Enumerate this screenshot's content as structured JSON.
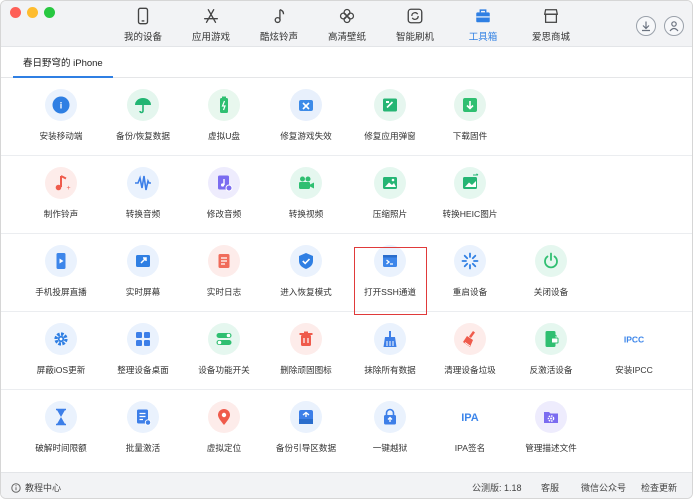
{
  "nav": [
    {
      "label": "我的设备",
      "icon": "phone-icon"
    },
    {
      "label": "应用游戏",
      "icon": "app-store-icon"
    },
    {
      "label": "酷炫铃声",
      "icon": "music-note-icon"
    },
    {
      "label": "高清壁纸",
      "icon": "flower-icon"
    },
    {
      "label": "智能刷机",
      "icon": "refresh-box-icon"
    },
    {
      "label": "工具箱",
      "icon": "toolbox-icon",
      "active": true
    },
    {
      "label": "爱思商城",
      "icon": "shop-icon"
    }
  ],
  "device_tab": "春日野穹的 iPhone",
  "tools": [
    [
      "安装移动端",
      "备份/恢复数据",
      "虚拟U盘",
      "修复游戏失效",
      "修复应用弹窗",
      "下载固件"
    ],
    [
      "制作铃声",
      "转换音频",
      "修改音频",
      "转换视频",
      "压缩照片",
      "转换HEIC图片"
    ],
    [
      "手机投屏直播",
      "实时屏幕",
      "实时日志",
      "进入恢复模式",
      "打开SSH通道",
      "重启设备",
      "关闭设备"
    ],
    [
      "屏蔽iOS更新",
      "整理设备桌面",
      "设备功能开关",
      "删除顽固图标",
      "抹除所有数据",
      "清理设备垃圾",
      "反激活设备",
      "安装IPCC"
    ],
    [
      "破解时间限额",
      "批量激活",
      "虚拟定位",
      "备份引导区数据",
      "一键越狱",
      "IPA签名",
      "管理描述文件"
    ]
  ],
  "icon_text": {
    "ipcc": "IPCC",
    "ipa": "IPA"
  },
  "highlighted_tool": "打开SSH通道",
  "footer": {
    "tutorial": "教程中心",
    "version": "公测版: 1.18",
    "support": "客服",
    "wechat": "微信公众号",
    "update": "检查更新"
  },
  "colors": {
    "accent": "#2f7fe3",
    "highlight": "#e03a3a"
  }
}
